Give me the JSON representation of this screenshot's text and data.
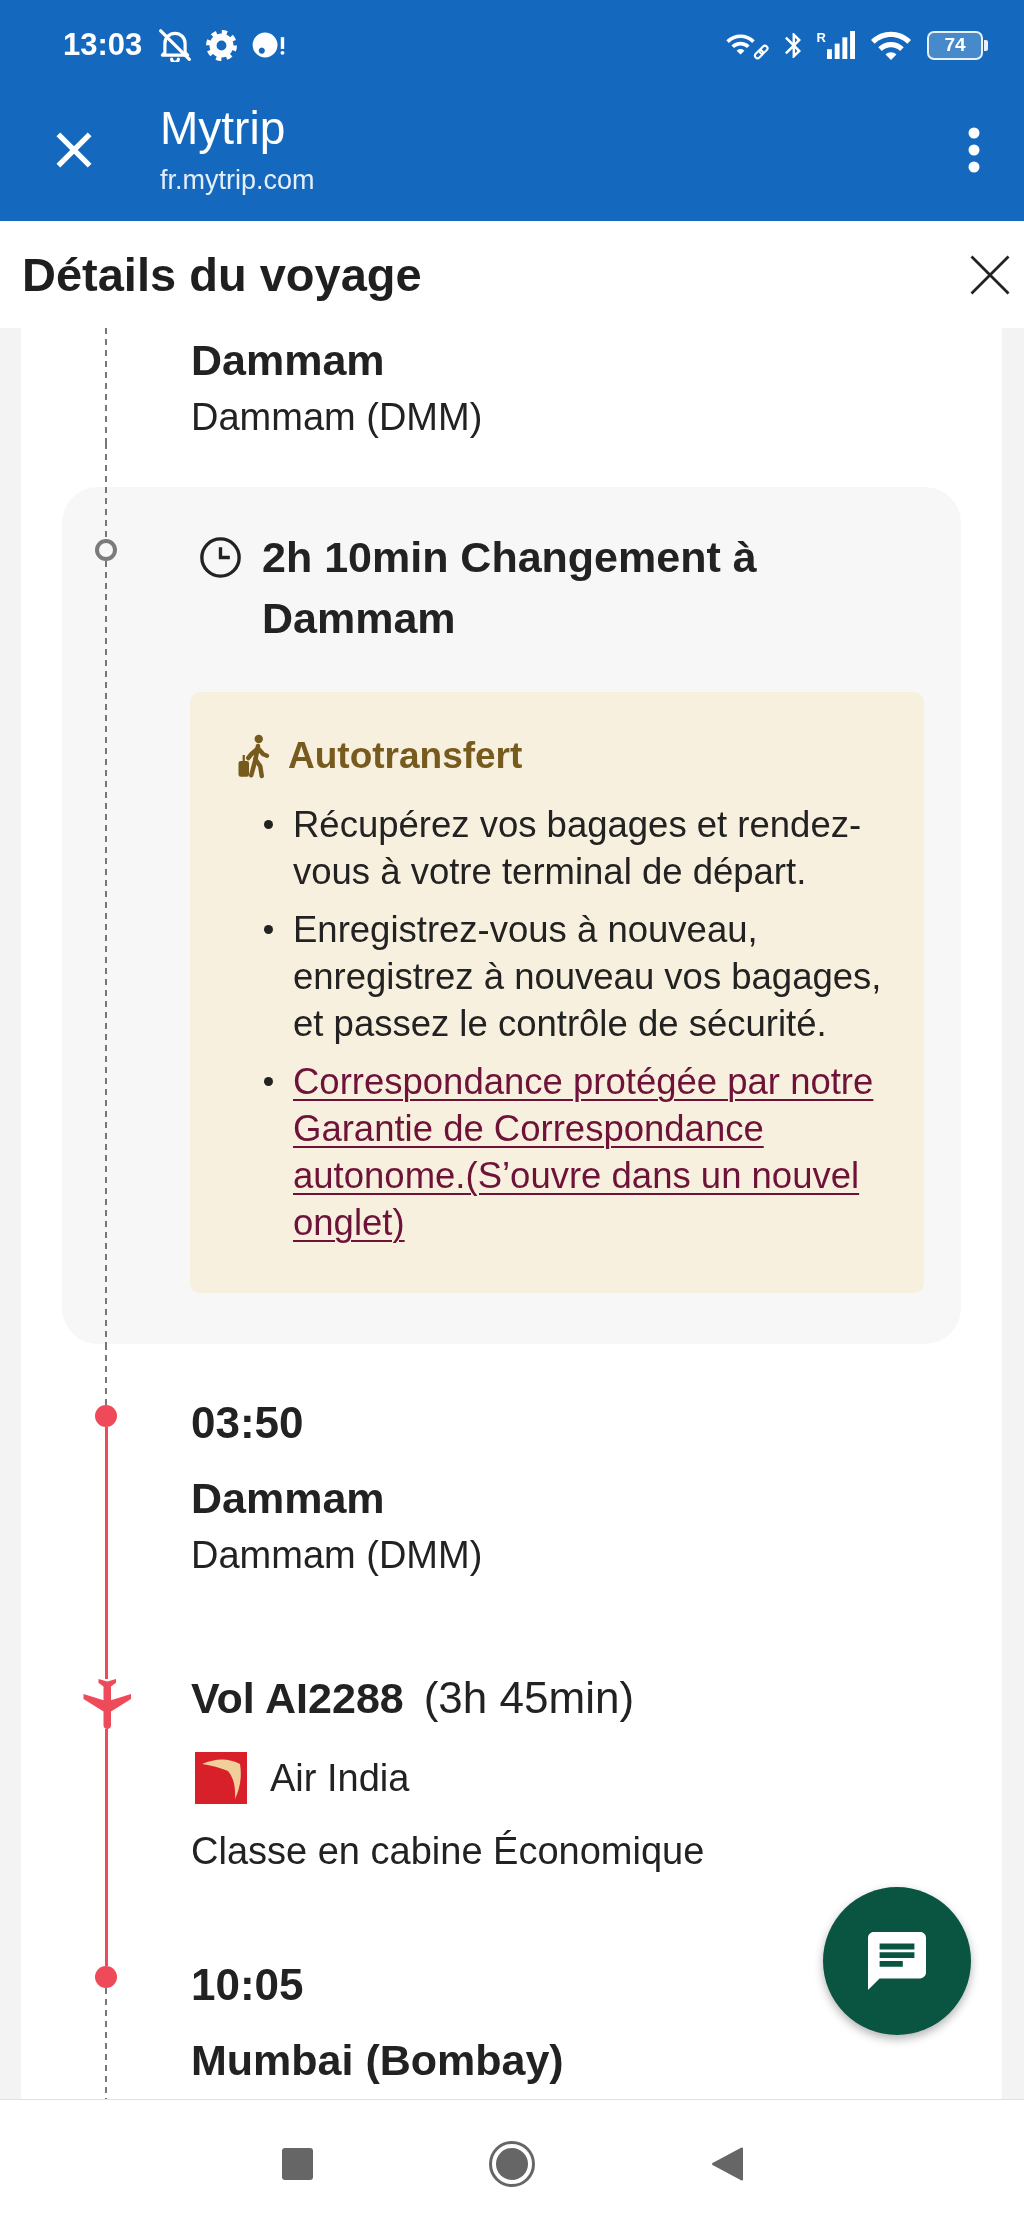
{
  "status_bar": {
    "time": "13:03",
    "network_label": "R",
    "battery": "74"
  },
  "app_bar": {
    "title": "Mytrip",
    "url": "fr.mytrip.com"
  },
  "sheet": {
    "title": "Détails du voyage"
  },
  "timeline": [
    {
      "kind": "stop",
      "place": "Dammam",
      "airport": "Dammam (DMM)"
    },
    {
      "kind": "layover",
      "title": "2h 10min Changement à Dammam",
      "notice": {
        "title": "Autotransfert",
        "items": [
          {
            "kind": "text",
            "text": "Récupérez vos bagages et rendez-vous à votre terminal de départ."
          },
          {
            "kind": "text",
            "text": "Enregistrez-vous à nouveau, enregistrez à nouveau vos bagages, et passez le contrôle de sécurité."
          },
          {
            "kind": "link",
            "text": "Correspondance protégée par notre Garantie de Correspondance autonome.(S’ouvre dans un nouvel onglet)"
          }
        ]
      }
    },
    {
      "kind": "stop",
      "time": "03:50",
      "place": "Dammam",
      "airport": "Dammam (DMM)"
    },
    {
      "kind": "flight",
      "flight": "Vol AI2288",
      "duration": "(3h 45min)",
      "airline": "Air India",
      "cabin": "Classe en cabine Économique"
    },
    {
      "kind": "stop",
      "time": "10:05",
      "place": "Mumbai (Bombay)"
    }
  ]
}
